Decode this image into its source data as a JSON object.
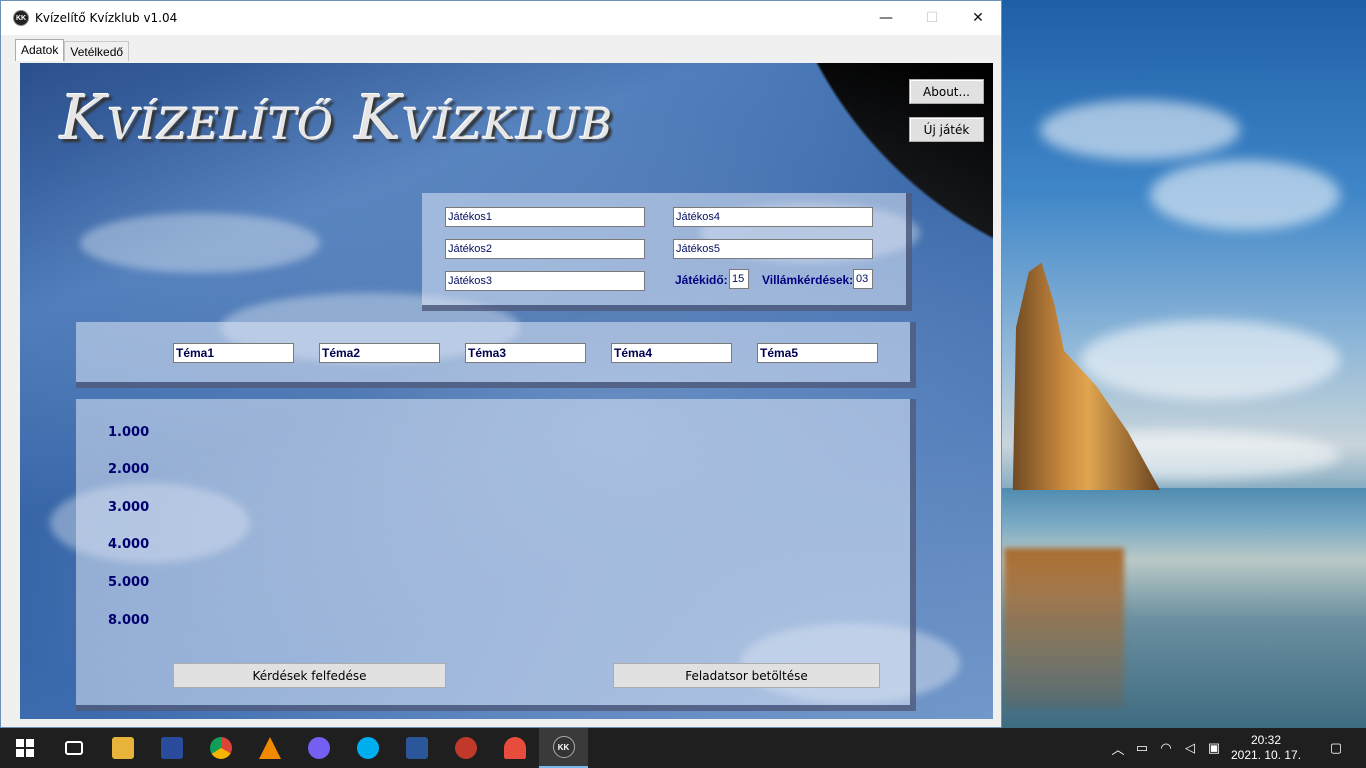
{
  "window": {
    "title": "Kvízelítő Kvízklub v1.04",
    "app_icon_text": "KK",
    "minimize": "—",
    "maximize": "☐",
    "close": "✕"
  },
  "tabs": [
    {
      "label": "Adatok",
      "active": true
    },
    {
      "label": "Vetélkedő",
      "active": false
    }
  ],
  "logo": "Kvízelítő Kvízklub",
  "buttons": {
    "about": "About...",
    "new_game": "Új játék",
    "reveal_questions": "Kérdések felfedése",
    "load_tasks": "Feladatsor betöltése"
  },
  "players": [
    "Játékos1",
    "Játékos2",
    "Játékos3",
    "Játékos4",
    "Játékos5"
  ],
  "settings": {
    "game_time_label": "Játékidő:",
    "game_time_value": "15",
    "lightning_label": "Villámkérdések:",
    "lightning_value": "03"
  },
  "topics": [
    "Téma1",
    "Téma2",
    "Téma3",
    "Téma4",
    "Téma5"
  ],
  "values": [
    "1.000",
    "2.000",
    "3.000",
    "4.000",
    "5.000",
    "8.000"
  ],
  "taskbar": {
    "apps": [
      {
        "name": "task-view",
        "glyph": "▭",
        "color": "#1f1f1f"
      },
      {
        "name": "file-explorer",
        "glyph": "▬",
        "color": "#e8b33a"
      },
      {
        "name": "save-app",
        "glyph": "▣",
        "color": "#2b4c9c"
      },
      {
        "name": "chrome",
        "glyph": "◉",
        "color": "#db4437"
      },
      {
        "name": "vlc",
        "glyph": "▲",
        "color": "#f08a00"
      },
      {
        "name": "viber",
        "glyph": "✆",
        "color": "#7360f2"
      },
      {
        "name": "skype",
        "glyph": "S",
        "color": "#00aff0"
      },
      {
        "name": "word",
        "glyph": "W",
        "color": "#2b579a"
      },
      {
        "name": "game-app",
        "glyph": "✱",
        "color": "#c0392b"
      },
      {
        "name": "paint-app",
        "glyph": "✎",
        "color": "#e74c3c"
      },
      {
        "name": "quiz-app",
        "glyph": "KK",
        "color": "#333333"
      }
    ],
    "time": "20:32",
    "date": "2021. 10. 17."
  }
}
